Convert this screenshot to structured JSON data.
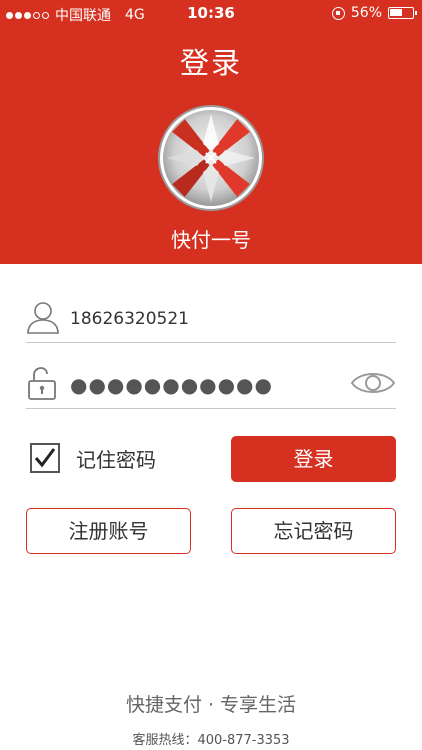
{
  "status_bar": {
    "carrier": "中国联通",
    "network": "4G",
    "time": "10:36",
    "battery": "56%",
    "battery_level": 0.56,
    "signal_bars": 3
  },
  "header": {
    "title": "登录",
    "app_name": "快付一号",
    "brand_color": "#d63120"
  },
  "form": {
    "username_value": "18626320521",
    "password_masked": "●●●●●●●●●●●",
    "remember_label": "记住密码",
    "remember_checked": true
  },
  "buttons": {
    "login": "登录",
    "register": "注册账号",
    "forgot": "忘记密码"
  },
  "footer": {
    "slogan": "快捷支付 · 专享生活",
    "hotline": "客服热线：400-877-3353"
  },
  "icons": {
    "user": "user-icon",
    "lock": "unlock-icon",
    "eye": "eye-icon",
    "logo": "app-logo",
    "check": "check-icon"
  }
}
